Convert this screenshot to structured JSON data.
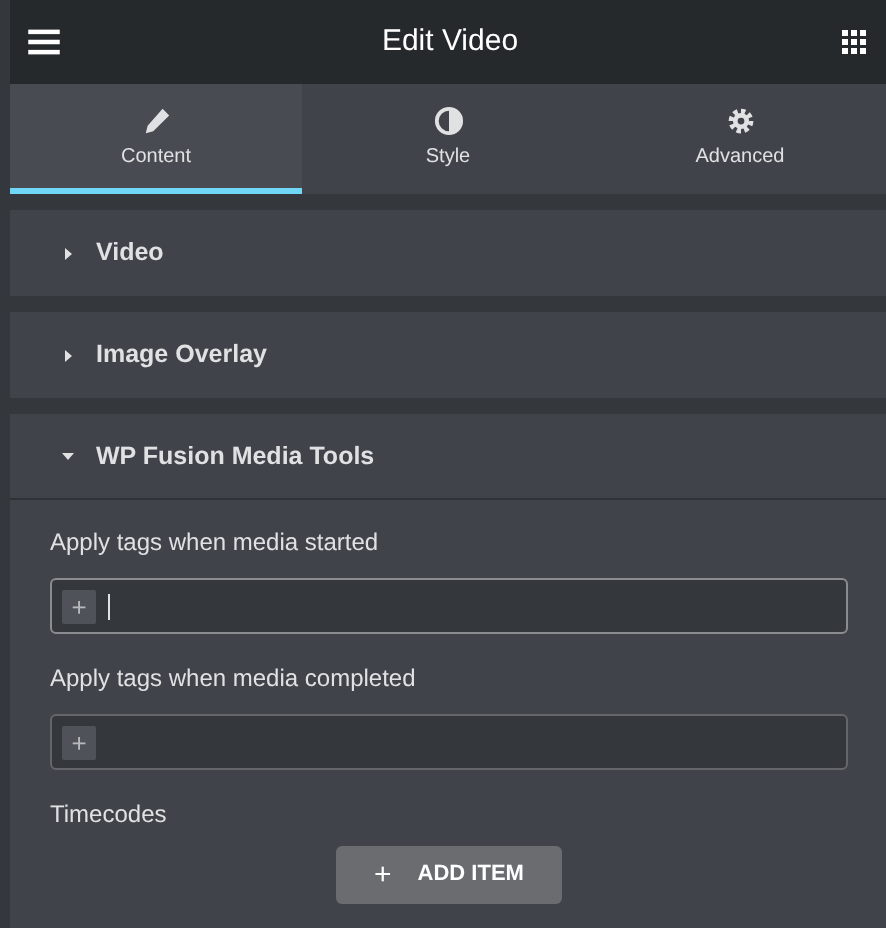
{
  "header": {
    "title": "Edit Video"
  },
  "tabs": [
    {
      "label": "Content",
      "selected": true
    },
    {
      "label": "Style",
      "selected": false
    },
    {
      "label": "Advanced",
      "selected": false
    }
  ],
  "sections": [
    {
      "title": "Video",
      "expanded": false
    },
    {
      "title": "Image Overlay",
      "expanded": false
    },
    {
      "title": "WP Fusion Media Tools",
      "expanded": true,
      "fields": [
        {
          "kind": "tags",
          "label": "Apply tags when media started",
          "add": "+",
          "focused": true
        },
        {
          "kind": "tags",
          "label": "Apply tags when media completed",
          "add": "+",
          "focused": false
        },
        {
          "kind": "repeater",
          "label": "Timecodes",
          "button": {
            "icon": "+",
            "label": "ADD ITEM"
          }
        }
      ]
    }
  ]
}
